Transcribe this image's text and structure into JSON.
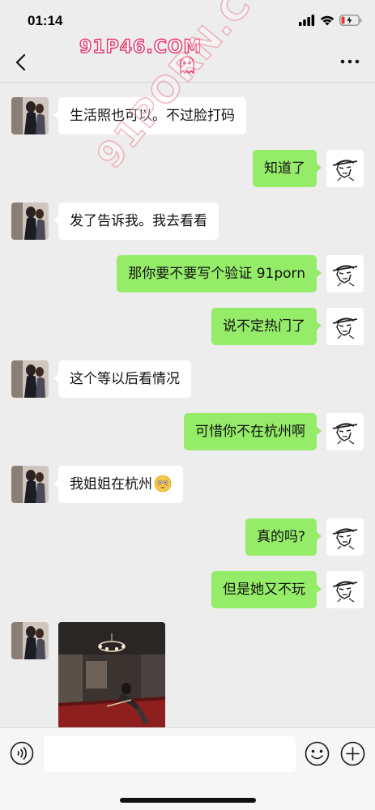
{
  "status_bar": {
    "time": "01:14"
  },
  "header": {
    "watermark": "91P46.COM"
  },
  "watermark_diagonal": "91PORN.COM",
  "messages": [
    {
      "side": "left",
      "text": "生活照也可以。不过脸打码"
    },
    {
      "side": "right",
      "text": "知道了"
    },
    {
      "side": "left",
      "text": "发了告诉我。我去看看"
    },
    {
      "side": "right",
      "text": "那你要不要写个验证  91porn"
    },
    {
      "side": "right",
      "text": "说不定热门了"
    },
    {
      "side": "left",
      "text": "这个等以后看情况"
    },
    {
      "side": "right",
      "text": "可惜你不在杭州啊"
    },
    {
      "side": "left",
      "text": "我姐姐在杭州"
    },
    {
      "side": "right",
      "text": "真的吗?"
    },
    {
      "side": "right",
      "text": "但是她又不玩"
    },
    {
      "side": "left",
      "type": "image"
    }
  ],
  "colors": {
    "background": "#ededed",
    "bubble_left": "#ffffff",
    "bubble_right": "#95ec69",
    "watermark": "#e53b6f"
  },
  "icons": [
    "back-icon",
    "more-icon",
    "voice-icon",
    "emoji-icon",
    "plus-icon",
    "ghost-icon",
    "signal-icon",
    "wifi-icon",
    "battery-icon"
  ]
}
